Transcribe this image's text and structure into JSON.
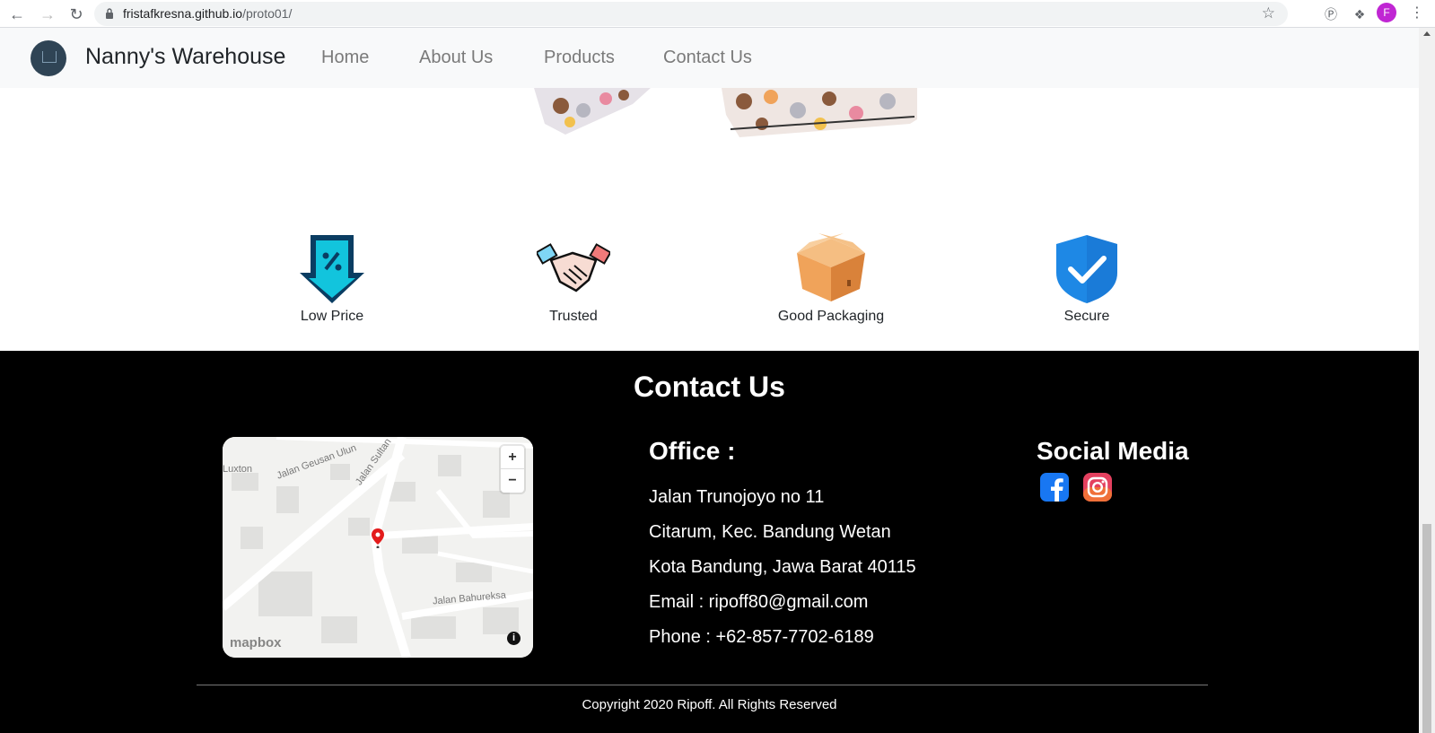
{
  "browser": {
    "url_host": "fristafkresna.github.io",
    "url_path": "/proto01/",
    "profile_initial": "F"
  },
  "navbar": {
    "brand": "Nanny's Warehouse",
    "links": [
      "Home",
      "About Us",
      "Products",
      "Contact Us"
    ]
  },
  "features": [
    {
      "label": "Low Price",
      "icon": "discount-arrow-icon"
    },
    {
      "label": "Trusted",
      "icon": "handshake-icon"
    },
    {
      "label": "Good Packaging",
      "icon": "box-icon"
    },
    {
      "label": "Secure",
      "icon": "shield-check-icon"
    }
  ],
  "footer": {
    "title": "Contact Us",
    "map": {
      "attribution": "mapbox",
      "streets": [
        "Jalan Geusan Ulun",
        "Jalan Sultan",
        "Luxton",
        "Jalan Bahureksa"
      ],
      "zoom_in": "+",
      "zoom_out": "−",
      "info": "i"
    },
    "office": {
      "heading": "Office :",
      "lines": [
        "Jalan Trunojoyo no 11",
        "Citarum, Kec. Bandung Wetan",
        "Kota Bandung, Jawa Barat 40115",
        "Email : ripoff80@gmail.com",
        "Phone : +62-857-7702-6189"
      ]
    },
    "social": {
      "heading": "Social Media",
      "icons": [
        "facebook-icon",
        "instagram-icon"
      ]
    },
    "copyright": "Copyright 2020 Ripoff. All Rights Reserved"
  },
  "colors": {
    "footer_bg": "#000000",
    "navbar_bg": "#f8f9fa",
    "feature_cyan": "#12c4dd",
    "shield_blue": "#1e88e5",
    "box_orange": "#f0a35a"
  }
}
